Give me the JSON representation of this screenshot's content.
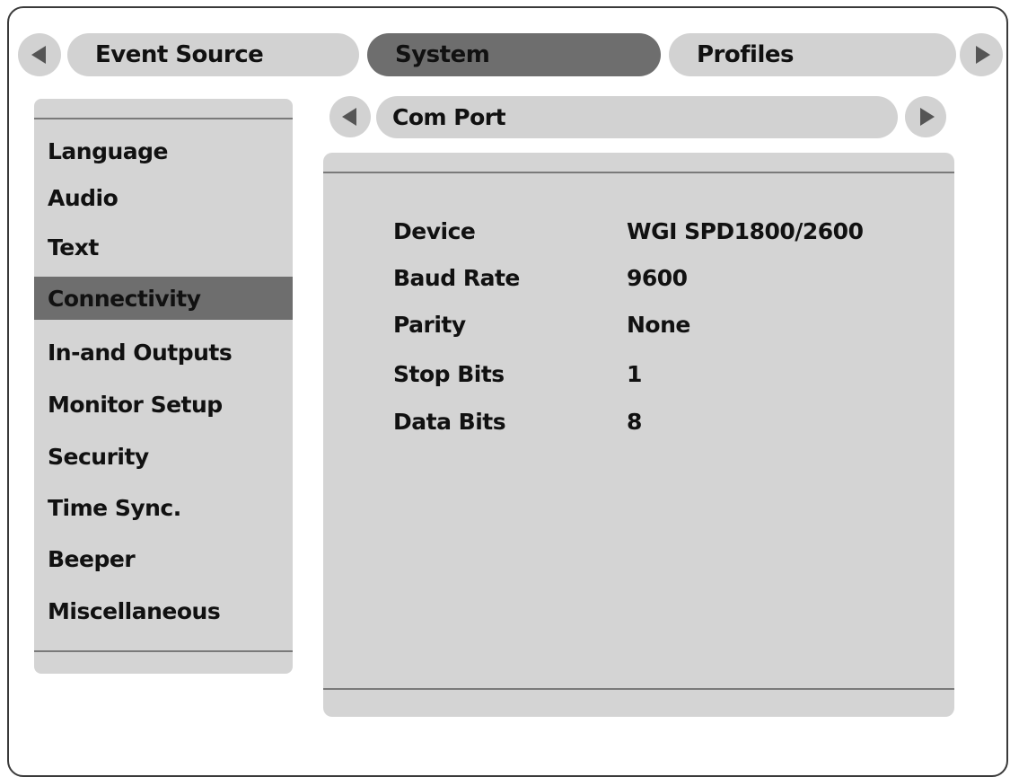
{
  "tabs": {
    "items": [
      {
        "label": "Event Source",
        "active": false
      },
      {
        "label": "System",
        "active": true
      },
      {
        "label": "Profiles",
        "active": false
      }
    ]
  },
  "sidebar": {
    "items": [
      {
        "label": "Language"
      },
      {
        "label": "Audio"
      },
      {
        "label": "Text"
      },
      {
        "label": "Connectivity",
        "selected": true
      },
      {
        "label": "In-and Outputs"
      },
      {
        "label": "Monitor Setup"
      },
      {
        "label": "Security"
      },
      {
        "label": "Time Sync."
      },
      {
        "label": "Beeper"
      },
      {
        "label": "Miscellaneous"
      }
    ]
  },
  "subnav": {
    "title": "Com Port"
  },
  "settings": {
    "rows": [
      {
        "label": "Device",
        "value": "WGI SPD1800/2600"
      },
      {
        "label": "Baud Rate",
        "value": "9600"
      },
      {
        "label": "Parity",
        "value": "None"
      },
      {
        "label": "Stop Bits",
        "value": "1"
      },
      {
        "label": "Data Bits",
        "value": "8"
      }
    ]
  },
  "colors": {
    "tab_inactive": "#d2d2d2",
    "tab_active": "#6e6e6e",
    "panel": "#d4d4d4",
    "selected_item": "#6e6e6e"
  },
  "icons": {
    "prev": "triangle-left-icon",
    "next": "triangle-right-icon"
  }
}
